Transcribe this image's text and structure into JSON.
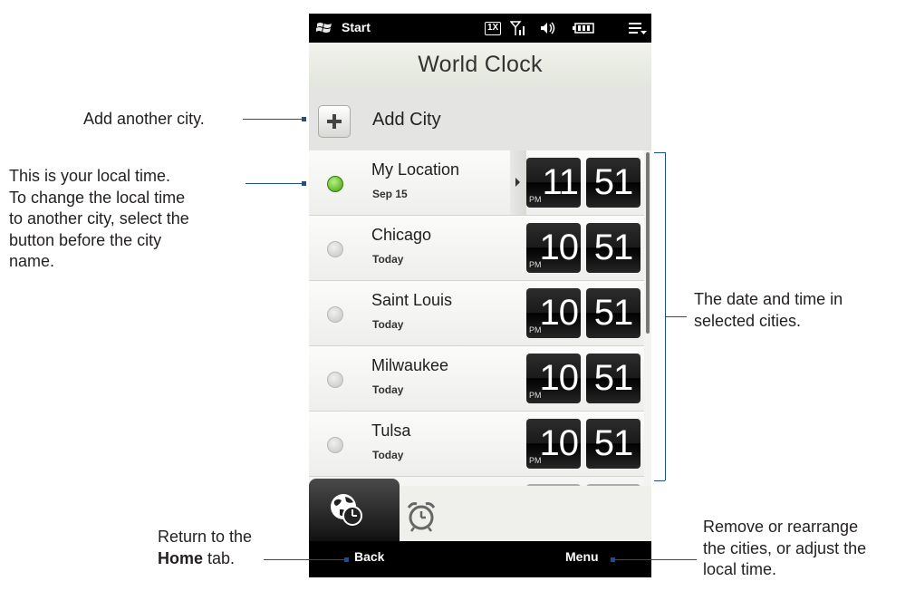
{
  "status_bar": {
    "start": "Start",
    "network": "1X",
    "icons": [
      "signal-icon",
      "volume-icon",
      "battery-icon",
      "connection-icon"
    ]
  },
  "title": "World Clock",
  "add_city": {
    "label": "Add City"
  },
  "cities": [
    {
      "name": "My Location",
      "date": "Sep 15",
      "ampm": "PM",
      "hour": "11",
      "minute": "51",
      "selected": true
    },
    {
      "name": "Chicago",
      "date": "Today",
      "ampm": "PM",
      "hour": "10",
      "minute": "51",
      "selected": false
    },
    {
      "name": "Saint Louis",
      "date": "Today",
      "ampm": "PM",
      "hour": "10",
      "minute": "51",
      "selected": false
    },
    {
      "name": "Milwaukee",
      "date": "Today",
      "ampm": "PM",
      "hour": "10",
      "minute": "51",
      "selected": false
    },
    {
      "name": "Tulsa",
      "date": "Today",
      "ampm": "PM",
      "hour": "10",
      "minute": "51",
      "selected": false
    }
  ],
  "tabs": [
    "world-clock-tab",
    "alarm-tab"
  ],
  "softkeys": {
    "left": "Back",
    "right": "Menu"
  },
  "annotations": {
    "add_city": "Add another city.",
    "local_time": [
      "This is your local time.",
      "To change the local time",
      "to another city, select the",
      "button before the city",
      "name."
    ],
    "date_time": [
      "The date and time in",
      "selected cities."
    ],
    "back_1": "Return to the",
    "back_2_bold": "Home",
    "back_2_rest": " tab.",
    "menu": [
      "Remove or rearrange",
      "the cities, or adjust the",
      "local time."
    ]
  },
  "colors": {
    "accent_line": "#1f4e8c",
    "selected_radio": "#3fa20e"
  }
}
